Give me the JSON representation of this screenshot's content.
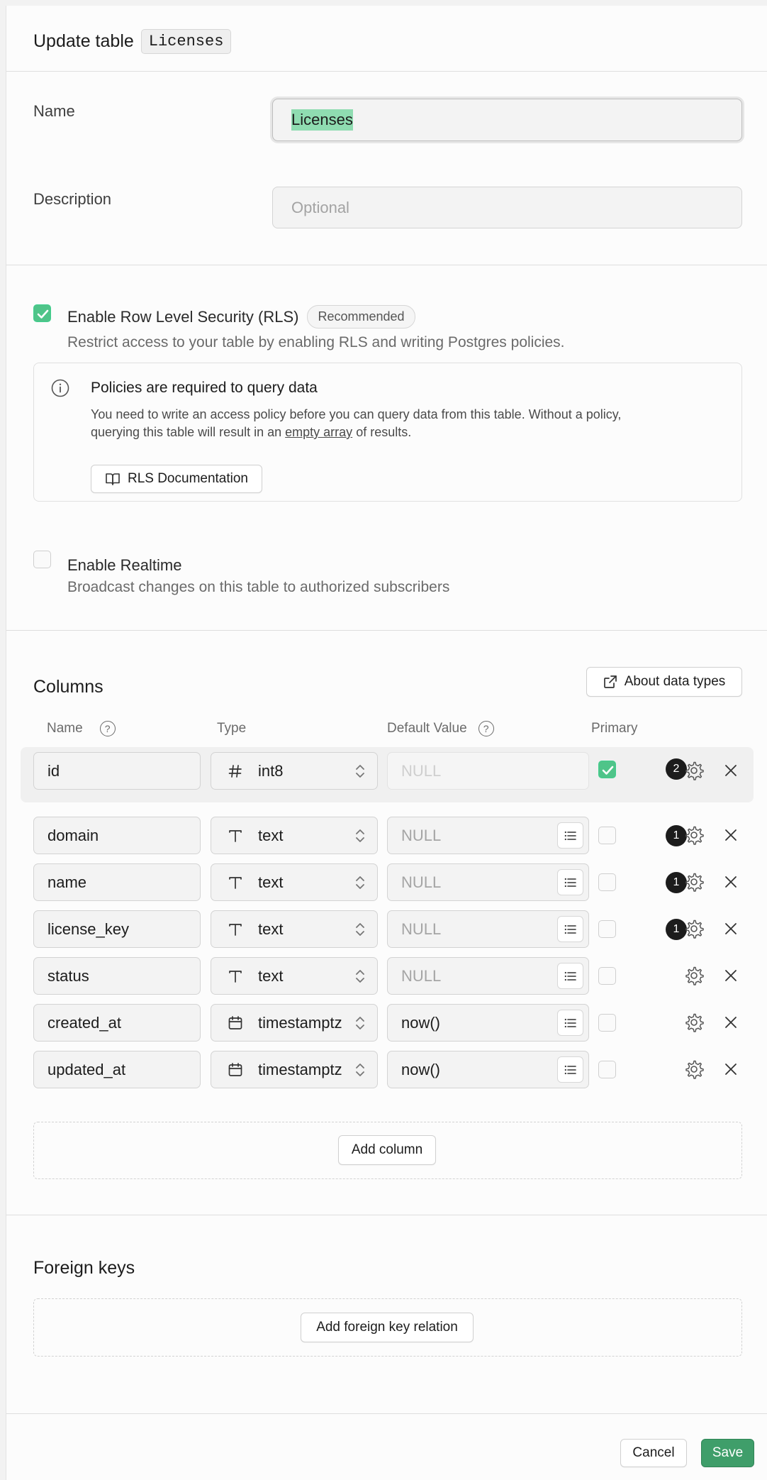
{
  "header": {
    "title": "Update table",
    "table_badge": "Licenses"
  },
  "form": {
    "name_label": "Name",
    "name_value": "Licenses",
    "description_label": "Description",
    "description_placeholder": "Optional"
  },
  "rls": {
    "title": "Enable Row Level Security (RLS)",
    "badge": "Recommended",
    "description": "Restrict access to your table by enabling RLS and writing Postgres policies.",
    "checked": true,
    "callout": {
      "title": "Policies are required to query data",
      "body_1": "You need to write an access policy before you can query data from this table. Without a policy,",
      "body_2_pre": "querying this table will result in an",
      "body_2_link": "empty array",
      "body_2_post": "of results.",
      "button": "RLS Documentation"
    }
  },
  "realtime": {
    "title": "Enable Realtime",
    "description": "Broadcast changes on this table to authorized subscribers",
    "checked": false
  },
  "columns": {
    "title": "Columns",
    "about_button": "About data types",
    "headers": {
      "name": "Name",
      "type": "Type",
      "default": "Default Value",
      "primary": "Primary"
    },
    "primary_row": {
      "name": "id",
      "type": "int8",
      "type_icon": "hash-icon",
      "default": "NULL",
      "primary": true,
      "badge": "2"
    },
    "rows": [
      {
        "name": "domain",
        "type": "text",
        "type_icon": "text-icon",
        "default": "NULL",
        "default_is_placeholder": true,
        "primary": false,
        "badge": "1"
      },
      {
        "name": "name",
        "type": "text",
        "type_icon": "text-icon",
        "default": "NULL",
        "default_is_placeholder": true,
        "primary": false,
        "badge": "1"
      },
      {
        "name": "license_key",
        "type": "text",
        "type_icon": "text-icon",
        "default": "NULL",
        "default_is_placeholder": true,
        "primary": false,
        "badge": "1"
      },
      {
        "name": "status",
        "type": "text",
        "type_icon": "text-icon",
        "default": "NULL",
        "default_is_placeholder": true,
        "primary": false,
        "badge": ""
      },
      {
        "name": "created_at",
        "type": "timestamptz",
        "type_icon": "calendar-icon",
        "default": "now()",
        "default_is_placeholder": false,
        "primary": false,
        "badge": ""
      },
      {
        "name": "updated_at",
        "type": "timestamptz",
        "type_icon": "calendar-icon",
        "default": "now()",
        "default_is_placeholder": false,
        "primary": false,
        "badge": ""
      }
    ],
    "add_button": "Add column"
  },
  "foreign_keys": {
    "title": "Foreign keys",
    "add_button": "Add foreign key relation"
  },
  "footer": {
    "cancel": "Cancel",
    "save": "Save"
  },
  "colors": {
    "accent_green": "#3f9e6a",
    "check_green": "#4fc489",
    "highlight": "#8fdcb1"
  }
}
